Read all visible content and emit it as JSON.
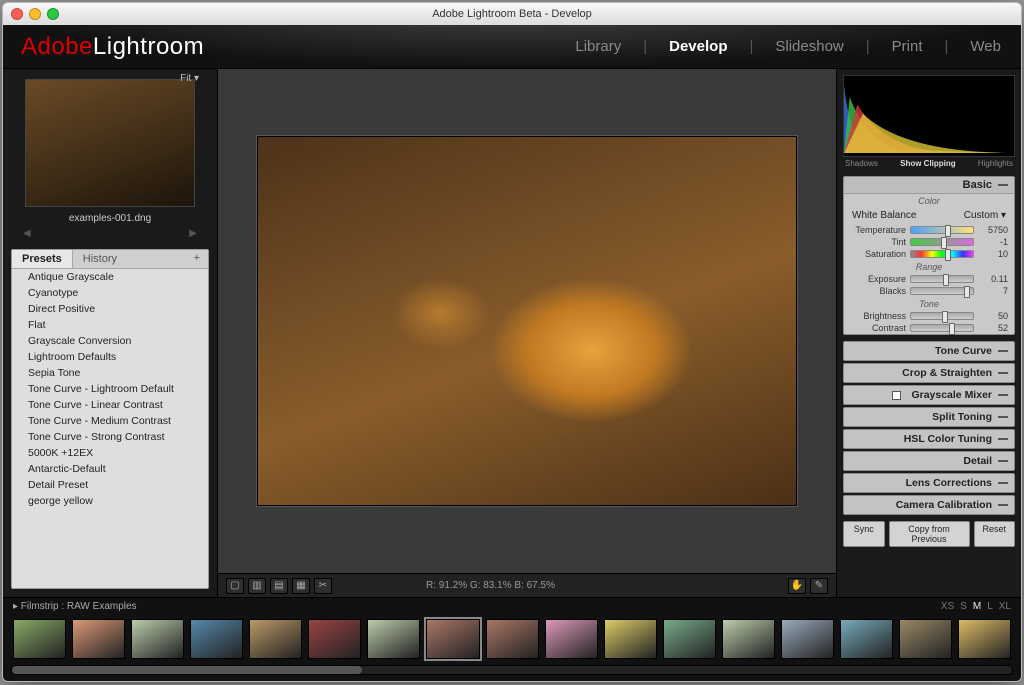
{
  "window": {
    "title": "Adobe Lightroom Beta - Develop"
  },
  "logo": {
    "brand": "Adobe",
    "product": "Lightroom"
  },
  "modules": {
    "items": [
      "Library",
      "Develop",
      "Slideshow",
      "Print",
      "Web"
    ],
    "active": "Develop"
  },
  "navigator": {
    "fit_label": "Fit ▾",
    "filename": "examples-001.dng"
  },
  "left_tabs": {
    "presets": "Presets",
    "history": "History",
    "plus": "+"
  },
  "presets": [
    "Antique Grayscale",
    "Cyanotype",
    "Direct Positive",
    "Flat",
    "Grayscale Conversion",
    "Lightroom Defaults",
    "Sepia Tone",
    "Tone Curve - Lightroom Default",
    "Tone Curve - Linear Contrast",
    "Tone Curve - Medium Contrast",
    "Tone Curve - Strong Contrast",
    "5000K +12EX",
    "Antarctic-Default",
    "Detail Preset",
    "george yellow"
  ],
  "toolbar": {
    "rgb": "R: 91.2%  G: 83.1%  B: 67.5%"
  },
  "histogram": {
    "shadows": "Shadows",
    "show": "Show Clipping",
    "highlights": "Highlights"
  },
  "basic": {
    "panel_title": "Basic",
    "color_title": "Color",
    "white_balance_label": "White Balance",
    "white_balance_value": "Custom ▾",
    "temperature_label": "Temperature",
    "temperature_value": "5750",
    "tint_label": "Tint",
    "tint_value": "-1",
    "saturation_label": "Saturation",
    "saturation_value": "10",
    "range_title": "Range",
    "exposure_label": "Exposure",
    "exposure_value": "0.11",
    "blacks_label": "Blacks",
    "blacks_value": "7",
    "tone_title": "Tone",
    "brightness_label": "Brightness",
    "brightness_value": "50",
    "contrast_label": "Contrast",
    "contrast_value": "52"
  },
  "panels_collapsed": [
    {
      "label": "Tone Curve",
      "checkbox": false
    },
    {
      "label": "Crop & Straighten",
      "checkbox": false
    },
    {
      "label": "Grayscale Mixer",
      "checkbox": true
    },
    {
      "label": "Split Toning",
      "checkbox": false
    },
    {
      "label": "HSL Color Tuning",
      "checkbox": false
    },
    {
      "label": "Detail",
      "checkbox": false
    },
    {
      "label": "Lens Corrections",
      "checkbox": false
    },
    {
      "label": "Camera Calibration",
      "checkbox": false
    }
  ],
  "bottom_buttons": {
    "sync": "Sync",
    "copy": "Copy from Previous",
    "reset": "Reset"
  },
  "filmstrip": {
    "label": "▸ Filmstrip :  RAW Examples",
    "sizes": [
      "XS",
      "S",
      "M",
      "L",
      "XL"
    ],
    "active_size": "M",
    "count": 17,
    "selected_index": 7
  }
}
